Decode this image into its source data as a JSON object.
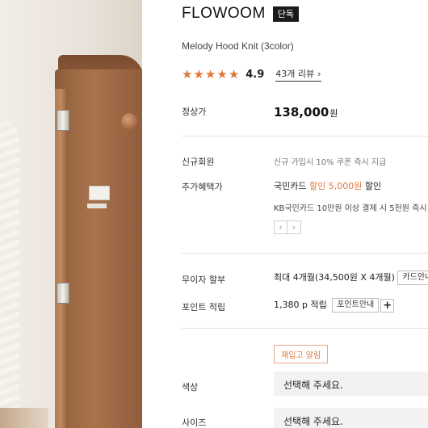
{
  "product": {
    "brand": "FLOWOOM",
    "badge": "단독",
    "name": "Melody Hood Knit (3color)",
    "rating": "4.9",
    "stars": 5,
    "review_link": "43개 리뷰",
    "review_chevron": "›"
  },
  "price": {
    "label": "정상가",
    "value": "138,000",
    "unit": "원"
  },
  "benefits": {
    "new_member_label": "신규회원",
    "new_member_text": "신규 가입시 10% 쿠폰 즉시 지급",
    "extra_label": "추가혜택가",
    "card_prefix": "국민카드 ",
    "card_discount_word": "할인",
    "card_amount": " 5,000원",
    "card_suffix": " 할인",
    "kb_text": "KB국민카드 10만원 이상 결제 시 5천원 즉시",
    "prev_label": "‹",
    "next_label": "›"
  },
  "installment": {
    "label": "무이자 할부",
    "text": "최대 4개월(34,500원 X 4개월)",
    "button": "카드안내"
  },
  "points": {
    "label": "포인트 적립",
    "text": "1,380 p 적립",
    "button": "포인트안내",
    "plus": "+"
  },
  "restock_button": "재입고 알림",
  "options": {
    "color_label": "색상",
    "color_placeholder": "선택해 주세요.",
    "size_label": "사이즈",
    "size_placeholder": "선택해 주세요."
  },
  "colors": {
    "accent": "#e0773a",
    "badge_bg": "#1a1a1a",
    "select_bg": "#f2f2f2"
  }
}
